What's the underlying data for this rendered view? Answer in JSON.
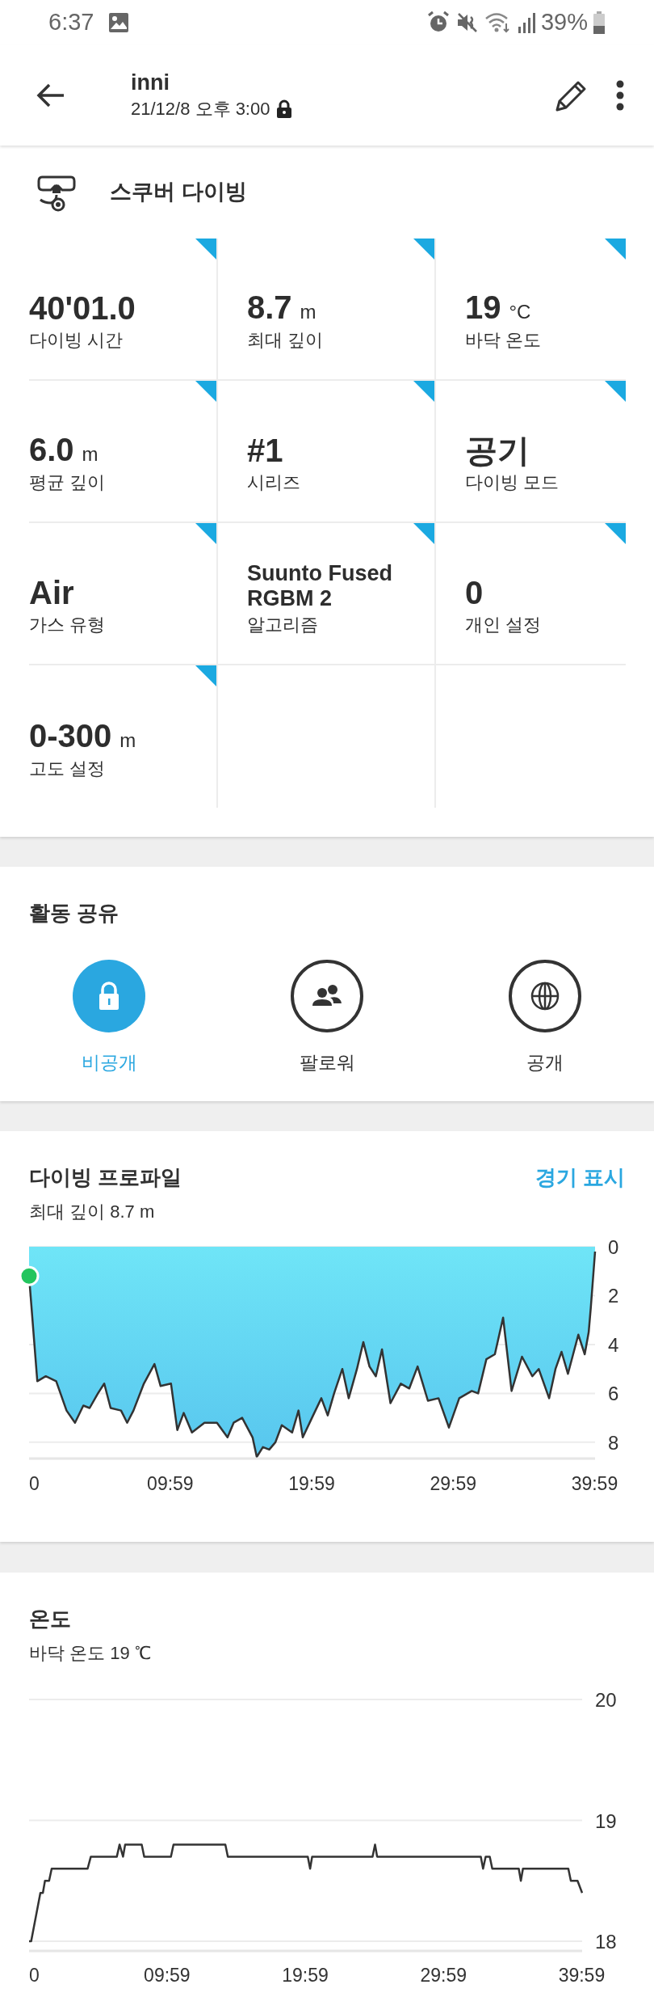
{
  "status_bar": {
    "time": "6:37",
    "battery": "39%"
  },
  "header": {
    "title": "inni",
    "subtitle": "21/12/8 오후 3:00"
  },
  "activity": {
    "title": "스쿠버 다이빙"
  },
  "stats": [
    {
      "kind": "value",
      "value": "40'01.0",
      "label": "다이빙 시간"
    },
    {
      "kind": "value",
      "value": "8.7",
      "unit": "m",
      "label": "최대 깊이"
    },
    {
      "kind": "value",
      "value": "19",
      "unit": "°C",
      "label": "바닥 온도"
    },
    {
      "kind": "value",
      "value": "6.0",
      "unit": "m",
      "label": "평균 깊이"
    },
    {
      "kind": "value",
      "value": "#1",
      "label": "시리즈"
    },
    {
      "kind": "value",
      "value": "공기",
      "label": "다이빙 모드"
    },
    {
      "kind": "value",
      "value": "Air",
      "label": "가스 유형"
    },
    {
      "kind": "multiline",
      "value": "Suunto Fused RGBM 2",
      "label": "알고리즘"
    },
    {
      "kind": "value",
      "value": "0",
      "label": "개인 설정"
    },
    {
      "kind": "value",
      "value": "0-300",
      "unit": "m",
      "label": "고도 설정"
    }
  ],
  "sharing": {
    "title": "활동 공유",
    "options": [
      {
        "kind": "private",
        "label": "비공개",
        "selected": true
      },
      {
        "kind": "followers",
        "label": "팔로워",
        "selected": false
      },
      {
        "kind": "public",
        "label": "공개",
        "selected": false
      }
    ]
  },
  "dive_profile": {
    "title": "다이빙 프로파일",
    "link": "경기 표시",
    "subtitle": "최대 깊이 8.7 m",
    "chart_data": {
      "type": "area",
      "xlim": [
        0,
        2401
      ],
      "ylim": [
        8.6,
        0
      ],
      "xticks": [
        {
          "value": 0,
          "label": "0"
        },
        {
          "value": 599,
          "label": "09:59"
        },
        {
          "value": 1199,
          "label": "19:59"
        },
        {
          "value": 1799,
          "label": "29:59"
        },
        {
          "value": 2399,
          "label": "39:59"
        }
      ],
      "yticks": [
        0,
        2,
        4,
        6,
        8
      ],
      "x": [
        0,
        35,
        71,
        115,
        159,
        195,
        230,
        257,
        292,
        319,
        346,
        390,
        416,
        443,
        487,
        532,
        558,
        602,
        629,
        656,
        691,
        744,
        797,
        842,
        868,
        904,
        948,
        966,
        992,
        1019,
        1045,
        1072,
        1116,
        1143,
        1161,
        1205,
        1240,
        1267,
        1294,
        1329,
        1356,
        1391,
        1418,
        1444,
        1471,
        1497,
        1533,
        1577,
        1613,
        1648,
        1692,
        1737,
        1781,
        1825,
        1878,
        1905,
        1940,
        1976,
        2011,
        2047,
        2091,
        2135,
        2162,
        2206,
        2233,
        2259,
        2286,
        2330,
        2357,
        2374,
        2383,
        2401
      ],
      "grid": true,
      "series": [
        {
          "color": "#333333",
          "values": [
            1.2,
            5.5,
            5.3,
            5.5,
            6.7,
            7.2,
            6.5,
            6.6,
            6.0,
            5.6,
            6.6,
            6.7,
            7.2,
            6.7,
            5.6,
            4.8,
            5.7,
            5.6,
            7.5,
            6.8,
            7.6,
            7.2,
            7.2,
            7.8,
            7.2,
            7.0,
            7.8,
            8.6,
            8.2,
            8.3,
            8.0,
            7.3,
            7.6,
            6.7,
            7.8,
            6.9,
            6.2,
            6.9,
            6.0,
            5.0,
            6.2,
            5.0,
            3.9,
            4.9,
            5.3,
            4.2,
            6.4,
            5.6,
            5.8,
            4.9,
            6.3,
            6.2,
            7.4,
            6.2,
            5.9,
            6.0,
            4.6,
            4.4,
            2.9,
            5.9,
            4.5,
            5.3,
            5.0,
            6.2,
            5.0,
            4.3,
            5.2,
            3.6,
            4.4,
            3.5,
            2.5,
            0.2
          ]
        }
      ]
    }
  },
  "temperature": {
    "title": "온도",
    "subtitle": "바닥 온도 19 ℃",
    "chart_data": {
      "type": "line",
      "xlim": [
        0,
        2401
      ],
      "ylim": [
        18,
        20
      ],
      "xticks": [
        {
          "value": 0,
          "label": "0"
        },
        {
          "value": 599,
          "label": "09:59"
        },
        {
          "value": 1199,
          "label": "19:59"
        },
        {
          "value": 1799,
          "label": "29:59"
        },
        {
          "value": 2399,
          "label": "39:59"
        }
      ],
      "yticks": [
        18,
        19,
        20
      ],
      "x": [
        0,
        9,
        49,
        60,
        69,
        87,
        98,
        254,
        268,
        381,
        393,
        408,
        417,
        489,
        500,
        616,
        627,
        852,
        863,
        1210,
        1220,
        1229,
        1491,
        1502,
        1511,
        1961,
        1971,
        1982,
        2000,
        2011,
        2126,
        2135,
        2144,
        2341,
        2352,
        2381,
        2401
      ],
      "grid": true,
      "series": [
        {
          "color": "#333333",
          "values": [
            18.0,
            18.0,
            18.4,
            18.4,
            18.5,
            18.5,
            18.6,
            18.6,
            18.7,
            18.7,
            18.8,
            18.7,
            18.8,
            18.8,
            18.7,
            18.7,
            18.8,
            18.8,
            18.7,
            18.7,
            18.6,
            18.7,
            18.7,
            18.8,
            18.7,
            18.7,
            18.6,
            18.7,
            18.7,
            18.6,
            18.6,
            18.5,
            18.6,
            18.6,
            18.5,
            18.5,
            18.4
          ]
        }
      ]
    }
  }
}
